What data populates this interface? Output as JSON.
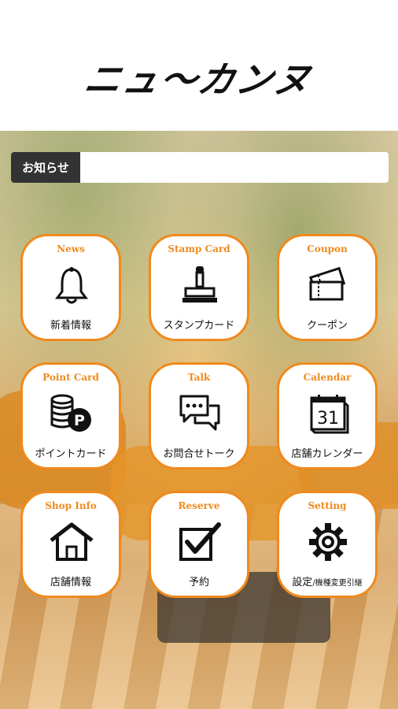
{
  "header": {
    "logo_text": "ニュ〜カンヌ"
  },
  "notice": {
    "label": "お知らせ"
  },
  "menu": [
    {
      "title": "News",
      "label": "新着情報",
      "icon": "bell-icon"
    },
    {
      "title": "Stamp Card",
      "label": "スタンプカード",
      "icon": "stamp-icon"
    },
    {
      "title": "Coupon",
      "label": "クーポン",
      "icon": "coupon-icon"
    },
    {
      "title": "Point Card",
      "label": "ポイントカード",
      "icon": "coins-icon"
    },
    {
      "title": "Talk",
      "label": "お問合せトーク",
      "icon": "chat-icon"
    },
    {
      "title": "Calendar",
      "label": "店舗カレンダー",
      "icon": "calendar-icon",
      "calendar_day": "31"
    },
    {
      "title": "Shop Info",
      "label": "店舗情報",
      "icon": "house-icon"
    },
    {
      "title": "Reserve",
      "label": "予約",
      "icon": "checkbox-icon"
    },
    {
      "title": "Setting",
      "label": "設定",
      "label_small": "/機種変更引継",
      "icon": "gear-icon"
    }
  ],
  "colors": {
    "accent": "#ef8a1e",
    "notice_label_bg": "#333333"
  }
}
